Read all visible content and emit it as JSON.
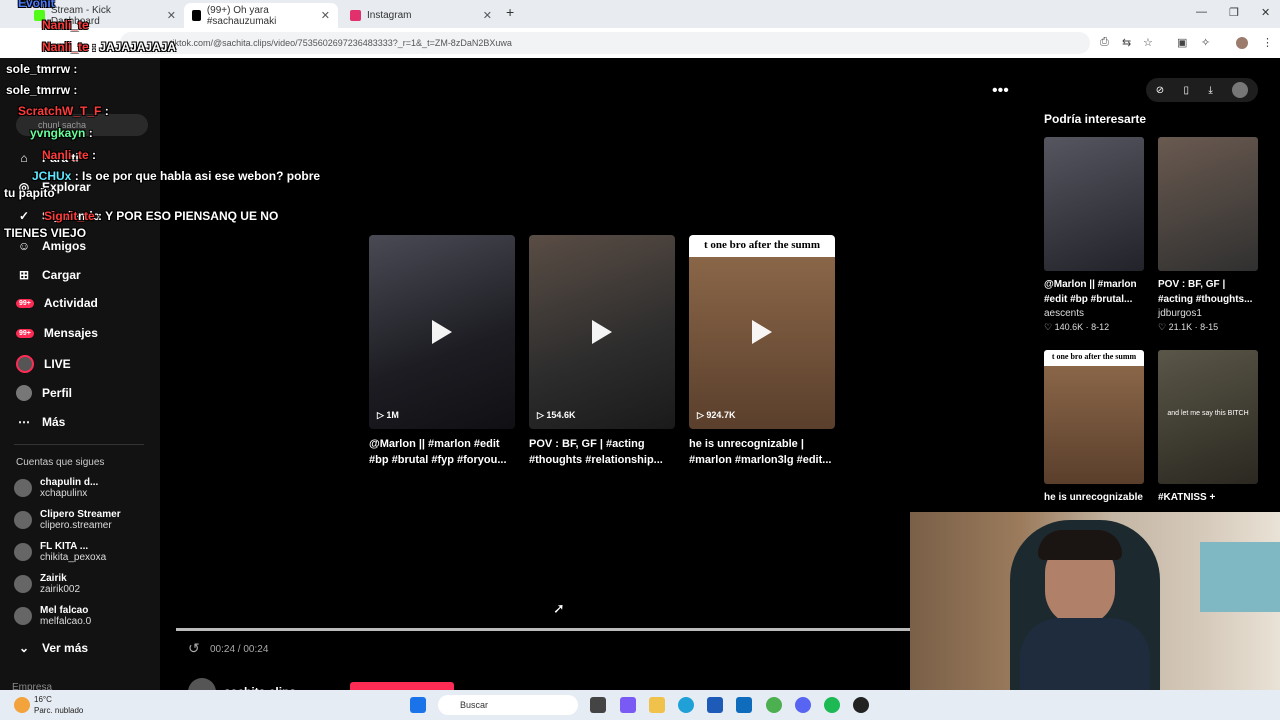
{
  "browser": {
    "tabs": [
      {
        "label": "Stream - Kick Dashboard",
        "fav_color": "#53fc18"
      },
      {
        "label": "(99+) Oh yara #sachauzumaki",
        "fav_color": "#000000"
      },
      {
        "label": "Instagram",
        "fav_color": "#e1306c"
      }
    ],
    "url": "tiktok.com/@sachita.clips/video/7535602697236483333?_r=1&_t=ZM-8zDaN2BXuwa"
  },
  "sidebar": {
    "search_placeholder": "chunl sacha",
    "items": [
      {
        "label": "Para ti",
        "icon": "home-icon"
      },
      {
        "label": "Explorar",
        "icon": "compass-icon"
      },
      {
        "label": "Siguiendo",
        "icon": "following-icon"
      },
      {
        "label": "Amigos",
        "icon": "friends-icon"
      },
      {
        "label": "Cargar",
        "icon": "upload-icon"
      },
      {
        "label": "Actividad",
        "icon": "activity-icon",
        "badge": "99+"
      },
      {
        "label": "Mensajes",
        "icon": "messages-icon",
        "badge": "99+"
      },
      {
        "label": "LIVE",
        "icon": "live-icon"
      },
      {
        "label": "Perfil",
        "icon": "profile-icon"
      },
      {
        "label": "Más",
        "icon": "more-icon"
      }
    ],
    "following_header": "Cuentas que sigues",
    "following": [
      {
        "name": "chapulin d...",
        "handle": "xchapulinx"
      },
      {
        "name": "Clipero Streamer",
        "handle": "clipero.streamer"
      },
      {
        "name": "FL KITA ...",
        "handle": "chikita_pexoxa"
      },
      {
        "name": "Zairik",
        "handle": "zairik002"
      },
      {
        "name": "Mel falcao",
        "handle": "melfalcao.0"
      }
    ],
    "see_more": "Ver más",
    "footer_partial": "Empresa"
  },
  "chat": [
    {
      "user": "Evonit",
      "text": "",
      "color": "#4a7bff"
    },
    {
      "user": "Nanli_te",
      "text": "",
      "color": "#ff3b3b"
    },
    {
      "user": "Nanli_te",
      "text": ": JAJAJAJAJA",
      "color": "#ff3b3b"
    },
    {
      "user": "sole_tmrrw",
      "text": ":",
      "color": "#ffffff"
    },
    {
      "user": "sole_tmrrw",
      "text": ":",
      "color": "#ffffff"
    },
    {
      "user": "ScratchW_T_F",
      "text": ":",
      "color": "#ff3b3b"
    },
    {
      "user": "yvngkayn",
      "text": ":",
      "color": "#67ff9a"
    },
    {
      "user": "Nanli_te",
      "text": ":",
      "color": "#ff3b3b"
    },
    {
      "user": "JCHUx",
      "text": ": Is oe por que habla asi ese webon?  pobre tu papito",
      "color": "#5ee8ff"
    },
    {
      "user": "Signit_te",
      "text": ": Y POR ESO PIENSANQ UE NO TIENES VIEJO",
      "color": "#ff3b3b"
    }
  ],
  "videos": [
    {
      "views": "1M",
      "title": "@Marlon || #marlon #edit #bp #brutal #fyp #foryou...",
      "bg": "#2a2a30"
    },
    {
      "views": "154.6K",
      "title": "POV : BF, GF | #acting #thoughts #relationship...",
      "bg": "#3a3a3a"
    },
    {
      "views": "924.7K",
      "title": "he is unrecognizable | #marlon #marlon3lg #edit...",
      "bg": "#6b4a36",
      "caption": "t one bro after the summ"
    }
  ],
  "player": {
    "time": "00:24 / 00:24",
    "progress": 1.0,
    "author": "sachita.clips"
  },
  "recommendations": {
    "title": "Podría interesarte",
    "items": [
      {
        "title": "@Marlon || #marlon #edit #bp #brutal...",
        "author": "aescents",
        "likes": "140.6K",
        "date": "8-12",
        "bg": "#2b2b35"
      },
      {
        "title": "POV : BF, GF | #acting #thoughts...",
        "author": "jdburgos1",
        "likes": "21.1K",
        "date": "8-15",
        "bg": "#3c3c3c"
      },
      {
        "title": "he is unrecognizable | #marlon",
        "author": "",
        "likes": "",
        "date": "",
        "bg": "#6b4a36",
        "caption": "t one bro after the summ"
      },
      {
        "title": "#KATNISS + #HAYMITCH || i had",
        "author": "",
        "likes": "",
        "date": "",
        "bg": "#3d3a30",
        "caption": "and let me say this BITCH"
      }
    ]
  },
  "taskbar": {
    "temp": "16°C",
    "weather": "Parc. nublado",
    "search": "Buscar"
  },
  "colors": {
    "accent": "#fe2c55",
    "bg": "#000000",
    "sidebar": "#121212"
  }
}
